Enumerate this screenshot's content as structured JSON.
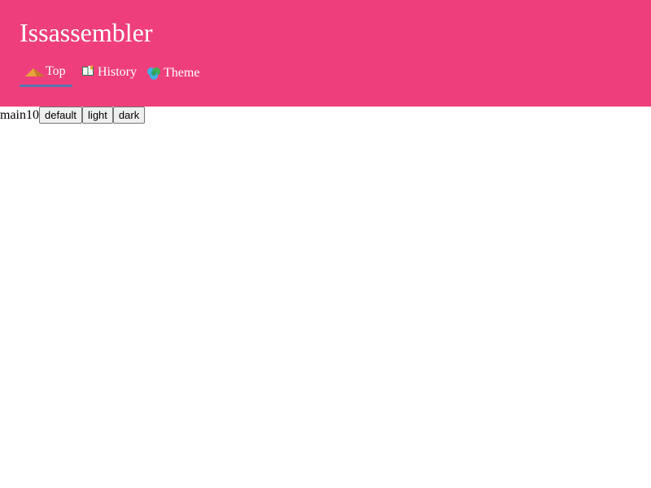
{
  "app": {
    "title": "Issassembler"
  },
  "header": {
    "background_color": "#ee3f7c",
    "tabs": [
      {
        "label": "Top",
        "icon": "mountain-icon",
        "active": true
      },
      {
        "label": "History",
        "icon": "open-book-icon",
        "active": false
      },
      {
        "label": "Theme",
        "icon": "palette-icon",
        "active": false
      }
    ],
    "active_indicator_color": "#5878b0"
  },
  "main": {
    "label": "main10",
    "theme_buttons": [
      {
        "label": "default"
      },
      {
        "label": "light"
      },
      {
        "label": "dark"
      }
    ]
  }
}
